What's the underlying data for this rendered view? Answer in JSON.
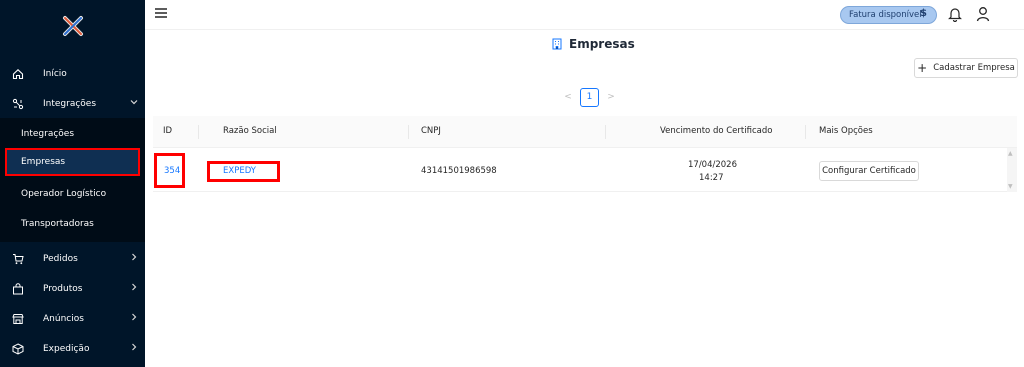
{
  "sidebar": {
    "brand_icon": "x-logo-icon",
    "items": [
      {
        "label": "Início",
        "icon": "home-icon"
      },
      {
        "label": "Integrações",
        "icon": "integrations-icon",
        "expanded": true
      },
      {
        "label": "Pedidos",
        "icon": "cart-icon"
      },
      {
        "label": "Produtos",
        "icon": "bag-icon"
      },
      {
        "label": "Anúncios",
        "icon": "store-icon"
      },
      {
        "label": "Expedição",
        "icon": "box-icon"
      }
    ],
    "sub_items": [
      {
        "label": "Integrações"
      },
      {
        "label": "Empresas",
        "active": true
      },
      {
        "label": "Operador Logístico"
      },
      {
        "label": "Transportadoras"
      }
    ]
  },
  "topbar": {
    "invoice_label": "Fatura disponível",
    "invoice_symbol": "$"
  },
  "main": {
    "title": "Empresas",
    "add_button": "Cadastrar Empresa",
    "pagination": {
      "current": "1"
    },
    "table": {
      "columns": [
        "ID",
        "Razão Social",
        "CNPJ",
        "Vencimento do Certificado",
        "Mais Opções"
      ],
      "rows": [
        {
          "id": "354",
          "razao_social": "EXPEDY",
          "cnpj": "43141501986598",
          "vencimento_date": "17/04/2026",
          "vencimento_time": "14:27",
          "action": "Configurar Certificado"
        }
      ]
    }
  },
  "colors": {
    "sidebar_bg": "#001529",
    "accent": "#1677ff",
    "highlight": "#ff0000"
  }
}
